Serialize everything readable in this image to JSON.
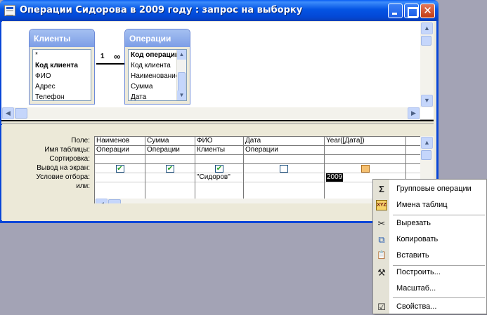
{
  "window": {
    "title": "Операции Сидорова в 2009 году : запрос на выборку",
    "close_glyph": "✕"
  },
  "tables": [
    {
      "name": "Клиенты",
      "fields": [
        "*",
        "Код клиента",
        "ФИО",
        "Адрес",
        "Телефон"
      ],
      "key_field": "Код клиента"
    },
    {
      "name": "Операции",
      "fields": [
        "Код операции",
        "Код клиента",
        "Наименование",
        "Сумма",
        "Дата"
      ],
      "key_field": "Код операции"
    }
  ],
  "relation": {
    "one": "1",
    "many": "∞"
  },
  "grid": {
    "row_labels": [
      "Поле:",
      "Имя таблицы:",
      "Сортировка:",
      "Вывод на экран:",
      "Условие отбора:",
      "или:"
    ],
    "columns": [
      {
        "field": "Наименов",
        "table": "Операции",
        "show": true,
        "condition": ""
      },
      {
        "field": "Сумма",
        "table": "Операции",
        "show": true,
        "condition": ""
      },
      {
        "field": "ФИО",
        "table": "Клиенты",
        "show": true,
        "condition": "\"Сидоров\""
      },
      {
        "field": "Дата",
        "table": "Операции",
        "show": false,
        "condition": ""
      },
      {
        "field": "Year([Дата])",
        "table": "",
        "show": false,
        "condition": "2009"
      }
    ]
  },
  "context_menu": {
    "items": [
      {
        "label": "Групповые операции",
        "icon": "sigma-icon",
        "glyph": "Σ"
      },
      {
        "label": "Имена таблиц",
        "icon": "xyz-table-names-icon",
        "glyph": "XYZ"
      },
      {
        "label": "Вырезать",
        "icon": "scissors-icon",
        "glyph": "✂"
      },
      {
        "label": "Копировать",
        "icon": "copy-icon",
        "glyph": "⧉"
      },
      {
        "label": "Вставить",
        "icon": "paste-icon",
        "glyph": "📋"
      },
      {
        "label": "Построить...",
        "icon": "builder-wand-icon",
        "glyph": "⚒"
      },
      {
        "label": "Масштаб...",
        "icon": "zoom-icon",
        "glyph": ""
      },
      {
        "label": "Свойства...",
        "icon": "properties-icon",
        "glyph": "☑"
      }
    ]
  },
  "colors": {
    "title_blue": "#0454e4",
    "desktop": "#a3a3b5",
    "check_green": "#21a121"
  }
}
